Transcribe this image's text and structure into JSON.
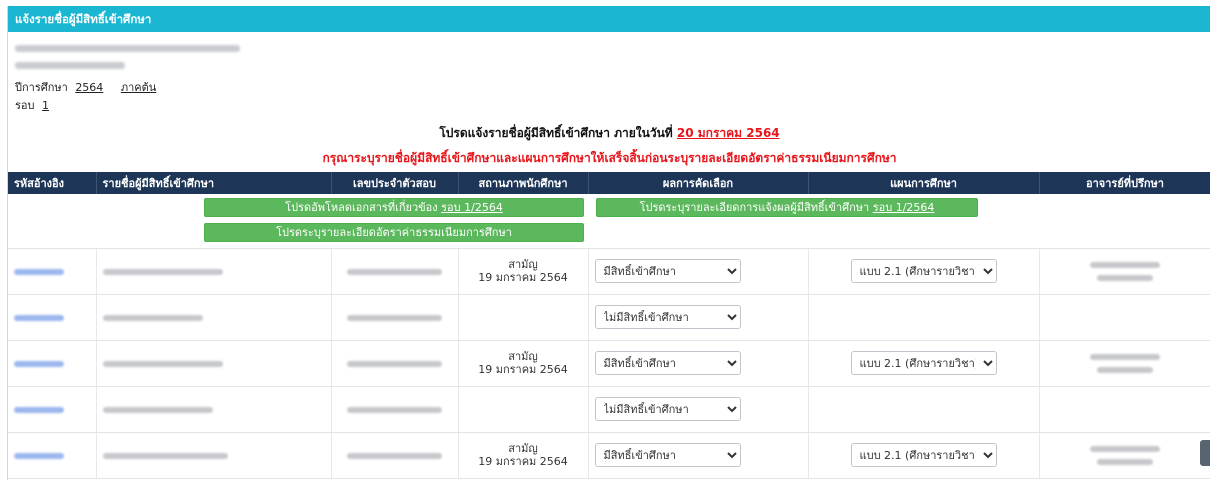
{
  "header": {
    "title": "แจ้งรายชื่อผู้มีสิทธิ์เข้าศึกษา"
  },
  "meta": {
    "year_label": "ปีการศึกษา",
    "year_value": "2564",
    "term": "ภาคต้น",
    "round_label": "รอบ",
    "round_value": "1"
  },
  "notice": {
    "line1_prefix": "โปรดแจ้งรายชื่อผู้มีสิทธิ์เข้าศึกษา ภายในวันที่",
    "line1_date": "20 มกราคม 2564",
    "line2": "กรุณาระบุรายชื่อผู้มีสิทธิ์เข้าศึกษาและแผนการศึกษาให้เสร็จสิ้นก่อนระบุรายละเอียดอัตราค่าธรรมเนียมการศึกษา"
  },
  "table": {
    "headers": [
      "รหัสอ้างอิง",
      "รายชื่อผู้มีสิทธิ์เข้าศึกษา",
      "เลขประจำตัวสอบ",
      "สถานภาพนักศึกษา",
      "ผลการคัดเลือก",
      "แผนการศึกษา",
      "อาจารย์ที่ปรึกษา"
    ],
    "actions": {
      "upload_prefix": "โปรดอัพโหลดเอกสารที่เกี่ยวข้อง",
      "upload_link": "รอบ 1/2564",
      "fee_detail": "โปรดระบุรายละเอียดอัตราค่าธรรมเนียมการศึกษา",
      "notify_prefix": "โปรดระบุรายละเอียดการแจ้งผลผู้มีสิทธิ์เข้าศึกษา",
      "notify_link": "รอบ 1/2564"
    },
    "rows": [
      {
        "status_line1": "สามัญ",
        "status_line2": "19 มกราคม 2564",
        "result": "มีสิทธิ์เข้าศึกษา",
        "plan": "แบบ 2.1 (ศึกษารายวิชา)"
      },
      {
        "status_line1": "",
        "status_line2": "",
        "result": "ไม่มีสิทธิ์เข้าศึกษา",
        "plan": ""
      },
      {
        "status_line1": "สามัญ",
        "status_line2": "19 มกราคม 2564",
        "result": "มีสิทธิ์เข้าศึกษา",
        "plan": "แบบ 2.1 (ศึกษารายวิชา)"
      },
      {
        "status_line1": "",
        "status_line2": "",
        "result": "ไม่มีสิทธิ์เข้าศึกษา",
        "plan": ""
      },
      {
        "status_line1": "สามัญ",
        "status_line2": "19 มกราคม 2564",
        "result": "มีสิทธิ์เข้าศึกษา",
        "plan": "แบบ 2.1 (ศึกษารายวิชา)"
      }
    ]
  },
  "colors": {
    "header_bg": "#1bb6d2",
    "table_head_bg": "#1d3557",
    "accent_red": "#e8151b",
    "button_green": "#5cb85c"
  }
}
